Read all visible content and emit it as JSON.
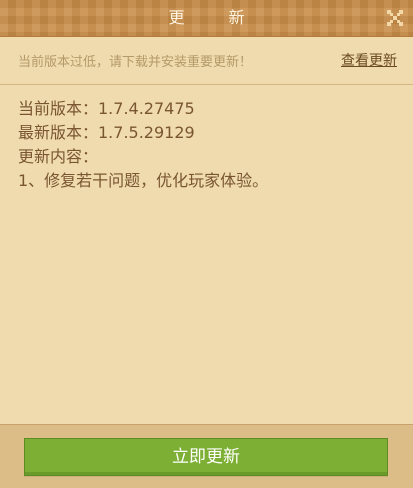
{
  "dialog": {
    "title": "更　新",
    "close_icon": "close-icon"
  },
  "notice": {
    "text": "当前版本过低，请下载并安装重要更新！",
    "link_label": "查看更新"
  },
  "content": {
    "current_version": "当前版本：1.7.4.27475",
    "latest_version": "最新版本：1.7.5.29129",
    "changes_heading": "更新内容：",
    "changes_item": "1、修复若干问题，优化玩家体验。"
  },
  "footer": {
    "update_button_label": "立即更新"
  },
  "colors": {
    "titlebar": "#c98e4a",
    "background": "#efdbad",
    "footer": "#ddbd87",
    "button": "#7caf33",
    "text": "#7a5630"
  }
}
